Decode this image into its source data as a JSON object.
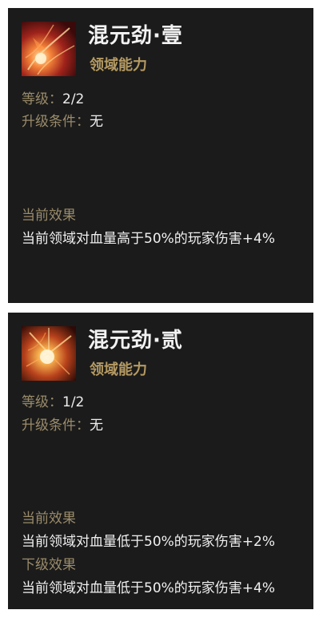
{
  "cards": [
    {
      "title": "混元劲·壹",
      "subtitle": "领域能力",
      "level_label": "等级：",
      "level_value": "2/2",
      "upgrade_label": "升级条件：",
      "upgrade_value": "无",
      "current_effect_title": "当前效果",
      "current_effect_text": "当前领域对血量高于50%的玩家伤害+4%",
      "icon": "fiery-swirl-skill-icon"
    },
    {
      "title": "混元劲·贰",
      "subtitle": "领域能力",
      "level_label": "等级：",
      "level_value": "1/2",
      "upgrade_label": "升级条件：",
      "upgrade_value": "无",
      "current_effect_title": "当前效果",
      "current_effect_text": "当前领域对血量低于50%的玩家伤害+2%",
      "next_effect_title": "下级效果",
      "next_effect_text": "当前领域对血量低于50%的玩家伤害+4%",
      "icon": "fiery-burst-skill-icon"
    }
  ],
  "colors": {
    "card_bg": "#1b1b1b",
    "title": "#f2f2f2",
    "subtitle": "#b59a62",
    "label": "#9a8b6a",
    "text": "#eeeeee"
  }
}
